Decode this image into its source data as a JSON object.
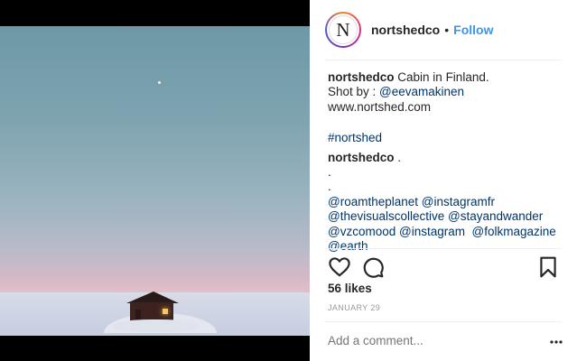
{
  "post": {
    "avatar_letter": "N",
    "username": "nortshedco",
    "separator": "•",
    "follow_label": "Follow"
  },
  "caption": {
    "author": "nortshedco",
    "text": "Cabin in Finland.",
    "shot_by_prefix": "Shot by : ",
    "shot_by_handle": "@eevamakinen",
    "website": "www.nortshed.com",
    "hashtag": "#nortshed",
    "comment_author": "nortshedco",
    "comment_text": ".",
    "dot_line_1": ".",
    "dot_line_2": ".",
    "mentions": [
      [
        "@roamtheplanet",
        "@instagramfr"
      ],
      [
        "@thevisualscollective",
        "@stayandwander"
      ],
      [
        "@vzcomood",
        "@instagram",
        "@folkmagazine"
      ],
      [
        "@earth"
      ]
    ]
  },
  "stats": {
    "likes": "56 likes",
    "date": "JANUARY 29"
  },
  "comment_box": {
    "placeholder": "Add a comment..."
  },
  "icons": {
    "like": "heart-icon",
    "comment": "comment-bubble-icon",
    "save": "bookmark-icon",
    "more": "more-options-icon"
  }
}
